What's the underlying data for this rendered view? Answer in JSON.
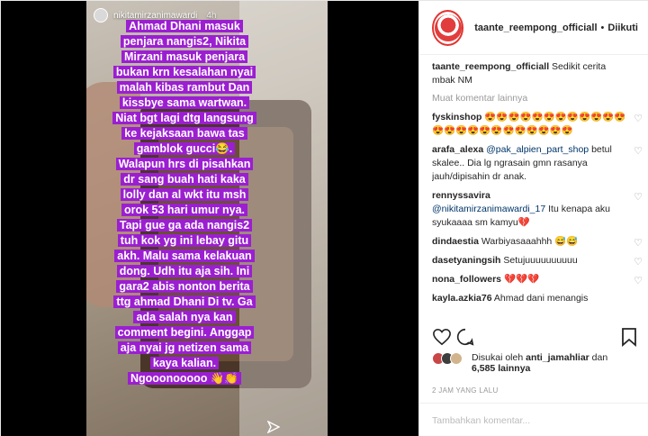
{
  "story": {
    "username": "nikitamirzanimawardi",
    "time": "4h",
    "caption_lines": [
      "Ahmad Dhani masuk",
      "penjara nangis2, Nikita",
      "Mirzani  masuk penjara",
      "bukan krn kesalahan nyai",
      "malah kibas rambut Dan",
      "kissbye sama wartwan.",
      "Niat bgt lagi dtg langsung",
      "ke kejaksaan bawa tas",
      "gamblok gucci😂.",
      "Walapun hrs di pisahkan",
      "dr sang buah hati kaka",
      "lolly dan al wkt itu msh",
      "orok 53 hari umur nya.",
      "Tapi gue ga ada nangis2",
      "tuh kok yg ini  lebay gitu",
      "akh. Malu sama kelakuan",
      "dong. Udh itu aja sih. Ini",
      "gara2 abis nonton berita",
      "ttg ahmad Dhani Di tv. Ga",
      "ada salah nya kan",
      "comment begini. Anggap",
      "aja nyai jg netizen sama",
      "kaya kalian.",
      "Ngooonooooo 👋👏"
    ]
  },
  "post": {
    "account": "taante_reempong_officiall",
    "separator": "•",
    "follow_status": "Diikuti",
    "caption_user": "taante_reempong_officiall",
    "caption_text": "Sedikit cerita mbak NM",
    "load_more": "Muat komentar lainnya",
    "comments": [
      {
        "user": "fyskinshop",
        "text": "😍😍😍😍😍😍😍😍😍😍😍😍😍😍😍😍😍😍😍😍😍😍😍😍"
      },
      {
        "user": "arafa_alexa",
        "mention": "@pak_alpien_part_shop",
        "text": "betul skalee.. Dia lg ngrasain gmn rasanya jauh/dipisahin dr anak."
      },
      {
        "user": "rennyssavira",
        "mention": "@nikitamirzanimawardi_17",
        "text": "Itu kenapa aku syukaaaa sm kamyu💔"
      },
      {
        "user": "dindaestia",
        "text": "Warbiyasaaahhh 😅😅"
      },
      {
        "user": "dasetyaningsih",
        "text": "Setujuuuuuuuuuu"
      },
      {
        "user": "nona_followers",
        "text": "💔💔💔"
      },
      {
        "user": "kayla.azkia76",
        "text": "Ahmad dani menangis"
      }
    ],
    "likes_prefix": "Disukai oleh",
    "likes_user": "anti_jamahliar",
    "likes_joiner": "dan",
    "likes_count": "6,585 lainnya",
    "timestamp": "2 JAM YANG LALU",
    "add_comment_placeholder": "Tambahkan komentar..."
  },
  "colors": {
    "caption_highlight": "#9b1fd1",
    "avatar_ring": "#e3342f",
    "link": "#003569",
    "muted": "#999999"
  },
  "icons": {
    "like": "heart-outline-icon",
    "comment": "comment-bubble-icon",
    "save": "bookmark-icon",
    "send": "send-arrow-icon"
  }
}
